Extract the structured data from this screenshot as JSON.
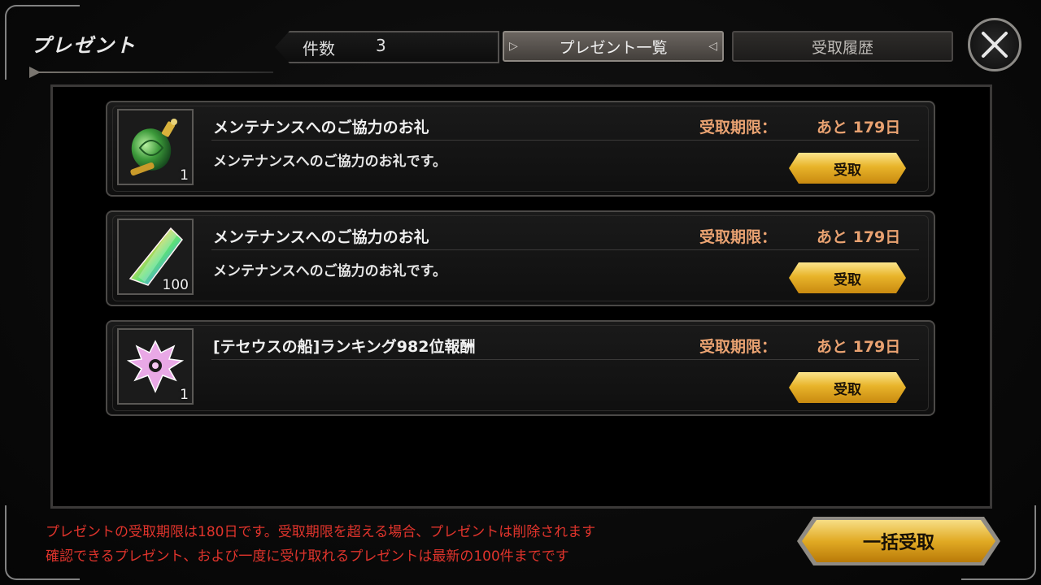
{
  "header": {
    "title": "プレゼント",
    "count_label": "件数",
    "count_value": "3",
    "tabs": [
      {
        "label": "プレゼント一覧",
        "active": true
      },
      {
        "label": "受取履歴",
        "active": false
      }
    ]
  },
  "items": [
    {
      "title": "メンテナンスへのご協力のお礼",
      "description": "メンテナンスへのご協力のお礼です。",
      "limit_label": "受取期限：",
      "limit_value": "あと 179日",
      "quantity": "1",
      "icon": "green-potion-icon",
      "claim_label": "受取"
    },
    {
      "title": "メンテナンスへのご協力のお礼",
      "description": "メンテナンスへのご協力のお礼です。",
      "limit_label": "受取期限：",
      "limit_value": "あと 179日",
      "quantity": "100",
      "icon": "rainbow-crystal-icon",
      "claim_label": "受取"
    },
    {
      "title": "[テセウスの船]ランキング982位報酬",
      "description": "",
      "limit_label": "受取期限：",
      "limit_value": "あと 179日",
      "quantity": "1",
      "icon": "pink-emblem-icon",
      "claim_label": "受取"
    }
  ],
  "footer": {
    "notice_line1": "プレゼントの受取期限は180日です。受取期限を超える場合、プレゼントは削除されます",
    "notice_line2": "確認できるプレゼント、および一度に受け取れるプレゼントは最新の100件までです",
    "claim_all_label": "一括受取"
  },
  "colors": {
    "limit_text": "#e9a271",
    "notice_text": "#e0342c",
    "gold_button": "#e1aa24"
  }
}
